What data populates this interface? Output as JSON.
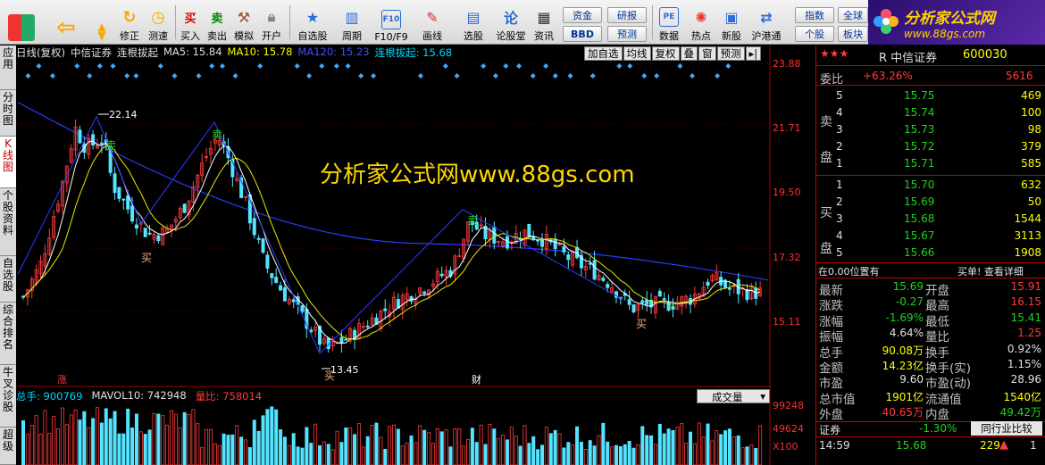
{
  "toolbar": {
    "buttons": [
      {
        "label": "修正",
        "icon": "up-arrow-icon"
      },
      {
        "label": "测速",
        "icon": "clock-icon"
      },
      {
        "label": "买入",
        "icon": "buy-icon"
      },
      {
        "label": "卖出",
        "icon": "sell-icon"
      },
      {
        "label": "模拟",
        "icon": "hammer-icon"
      },
      {
        "label": "开户",
        "icon": "lock-icon"
      },
      {
        "label": "自选股",
        "icon": "star-icon"
      },
      {
        "label": "周期",
        "icon": "period-icon"
      },
      {
        "label": "F10/F9",
        "icon": "f10-icon"
      },
      {
        "label": "画线",
        "icon": "pen-icon"
      },
      {
        "label": "选股",
        "icon": "screen-icon"
      },
      {
        "label": "论股堂",
        "icon": "forum-icon"
      },
      {
        "label": "资讯",
        "icon": "news-icon"
      },
      {
        "label": "数据",
        "icon": "pe-icon"
      },
      {
        "label": "热点",
        "icon": "hot-icon"
      },
      {
        "label": "新股",
        "icon": "new-stock-icon"
      },
      {
        "label": "沪港通",
        "icon": "hk-connect-icon"
      }
    ],
    "small_buttons": [
      "资金",
      "研报",
      "BBD",
      "预测",
      "指数",
      "全球",
      "个股",
      "板块"
    ],
    "buy_icon_text": "买",
    "sell_icon_text": "卖",
    "pe_icon_text": "PE",
    "f10_icon_text": "F10",
    "forum_icon_text": "论"
  },
  "logo": {
    "title": "分析家公式网",
    "url": "www.88gs.com"
  },
  "left_tabs": [
    {
      "label": "应用",
      "active": false
    },
    {
      "label": "分时图",
      "active": false
    },
    {
      "label": "K线图",
      "active": true
    },
    {
      "label": "个股资料",
      "active": false
    },
    {
      "label": "自选股",
      "active": false
    },
    {
      "label": "综合排名",
      "active": false
    },
    {
      "label": "牛叉诊股",
      "active": false
    },
    {
      "label": "超级",
      "active": false
    }
  ],
  "chart_header": {
    "period": "日线(复权)",
    "name": "中信证券",
    "indicator": "连根拔起",
    "ma5": "MA5: 15.84",
    "ma10": "MA10: 15.78",
    "ma120": "MA120: 15.23",
    "lgbq": "连根拔起: 15.68"
  },
  "chart_menu": [
    "加自选",
    "均线",
    "复权",
    "叠",
    "窗",
    "预测",
    "▸|"
  ],
  "watermark": "分析家公式网www.88gs.com",
  "annotations": {
    "high": "22.14",
    "low": "13.45",
    "buy": "买",
    "sell": "卖",
    "zhang": "涨",
    "cai": "财"
  },
  "volume_header": {
    "total": "总手: 900769",
    "mavol": "MAVOL10: 742948",
    "ratio": "量比: 758014",
    "selector": "成交量"
  },
  "price_axis": [
    "23.88",
    "21.71",
    "19.50",
    "17.32",
    "15.11"
  ],
  "volume_axis": [
    "99248",
    "49624",
    "X100"
  ],
  "stock": {
    "name": "R 中信证券",
    "code": "600030",
    "weibi_label": "委比",
    "weibi": "+63.26%",
    "weicha": "5616",
    "sell_label": "卖盘",
    "buy_label": "买盘",
    "asks": [
      {
        "lvl": "5",
        "price": "15.75",
        "vol": "469"
      },
      {
        "lvl": "4",
        "price": "15.74",
        "vol": "100"
      },
      {
        "lvl": "3",
        "price": "15.73",
        "vol": "98"
      },
      {
        "lvl": "2",
        "price": "15.72",
        "vol": "379"
      },
      {
        "lvl": "1",
        "price": "15.71",
        "vol": "585"
      }
    ],
    "bids": [
      {
        "lvl": "1",
        "price": "15.70",
        "vol": "632"
      },
      {
        "lvl": "2",
        "price": "15.69",
        "vol": "50"
      },
      {
        "lvl": "3",
        "price": "15.68",
        "vol": "1544"
      },
      {
        "lvl": "4",
        "price": "15.67",
        "vol": "3113"
      },
      {
        "lvl": "5",
        "price": "15.66",
        "vol": "1908"
      }
    ],
    "position_note": "在0.00位置有",
    "detail_link": "买单! 查看详细",
    "quote": [
      {
        "l1": "最新",
        "v1": "15.69",
        "c1": "green",
        "l2": "开盘",
        "v2": "15.91",
        "c2": "red"
      },
      {
        "l1": "涨跌",
        "v1": "-0.27",
        "c1": "green",
        "l2": "最高",
        "v2": "16.15",
        "c2": "red"
      },
      {
        "l1": "涨幅",
        "v1": "-1.69%",
        "c1": "green",
        "l2": "最低",
        "v2": "15.41",
        "c2": "green"
      },
      {
        "l1": "振幅",
        "v1": "4.64%",
        "c1": "white",
        "l2": "量比",
        "v2": "1.25",
        "c2": "red"
      },
      {
        "l1": "总手",
        "v1": "90.08万",
        "c1": "yel",
        "l2": "换手",
        "v2": "0.92%",
        "c2": "white"
      },
      {
        "l1": "金额",
        "v1": "14.23亿",
        "c1": "yel",
        "l2": "换手(实)",
        "v2": "1.15%",
        "c2": "white"
      },
      {
        "l1": "市盈",
        "v1": "9.60",
        "c1": "white",
        "l2": "市盈(动)",
        "v2": "28.96",
        "c2": "white"
      },
      {
        "l1": "总市值",
        "v1": "1901亿",
        "c1": "yel",
        "l2": "流通值",
        "v2": "1540亿",
        "c2": "yel"
      },
      {
        "l1": "外盘",
        "v1": "40.65万",
        "c1": "red",
        "l2": "内盘",
        "v2": "49.42万",
        "c2": "green"
      }
    ],
    "sector_label": "证券",
    "sector_change": "-1.30%",
    "compare_button": "同行业比较",
    "tick": {
      "time": "14:59",
      "price": "15.68",
      "vol": "229",
      "side": "1"
    }
  },
  "colors": {
    "up": "#ff3b3b",
    "down": "#1fd41f",
    "ma5": "#ffffff",
    "ma10": "#e8e800",
    "ma120": "#2a3cff",
    "cyan": "#54e4ff"
  }
}
